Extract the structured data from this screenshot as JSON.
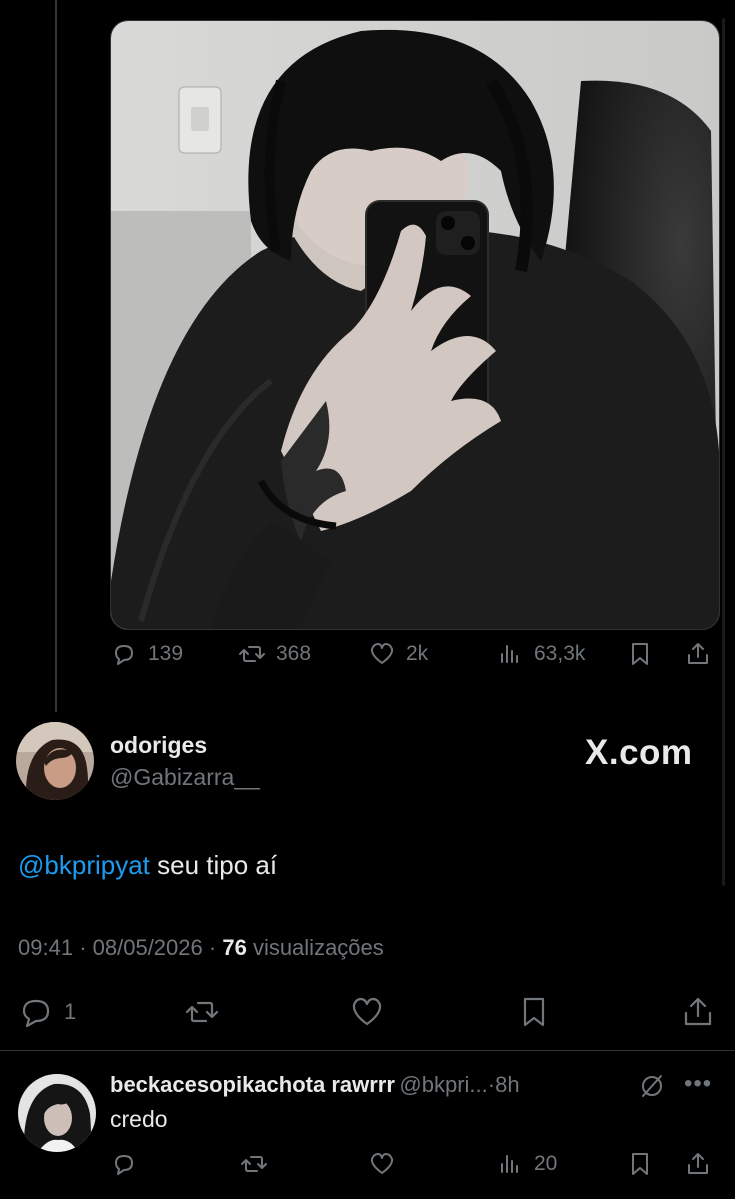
{
  "quoted_post": {
    "actions": {
      "replies": "139",
      "reposts": "368",
      "likes": "2k",
      "views": "63,3k"
    }
  },
  "main_post": {
    "display_name": "odoriges",
    "handle": "@Gabizarra__",
    "watermark": "X.com",
    "mention": "@bkpripyat",
    "text": " seu tipo aí",
    "time": "09:41",
    "date": "08/05/2026",
    "views_count": "76",
    "views_label": "visualizações",
    "separator": "·",
    "reply_count": "1"
  },
  "reply": {
    "display_name": "beckacesopikachota rawrrr",
    "handle": "@bkpri...",
    "separator": "·",
    "age": "8h",
    "text": "credo",
    "views": "20"
  },
  "icons": {
    "reply": "speech-bubble-icon",
    "repost": "repost-arrows-icon",
    "like": "heart-icon",
    "views": "bar-chart-icon",
    "bookmark": "bookmark-icon",
    "share": "share-upload-icon",
    "grok": "grok-icon",
    "more": "more-dots-icon"
  },
  "colors": {
    "background": "#000000",
    "text": "#e7e9ea",
    "muted": "#71767b",
    "link": "#1d9bf0"
  }
}
